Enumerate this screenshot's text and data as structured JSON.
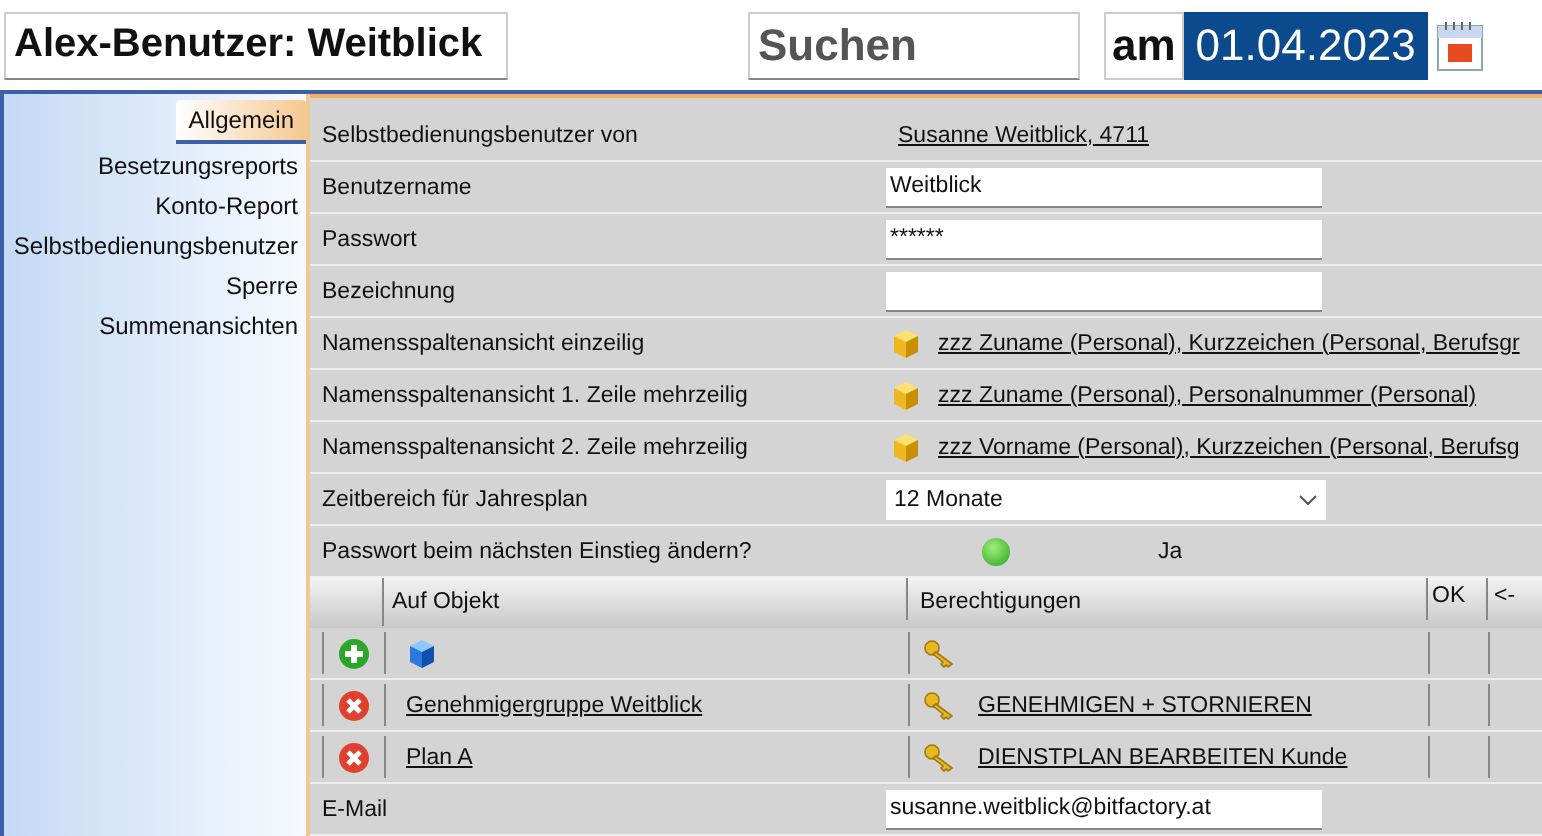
{
  "header": {
    "title": "Alex-Benutzer: Weitblick",
    "search": {
      "placeholder": "Suchen"
    },
    "date_label": "am",
    "date": "01.04.2023"
  },
  "sidebar": {
    "items": [
      {
        "label": "Allgemein",
        "selected": true
      },
      {
        "label": "Besetzungsreports",
        "selected": false
      },
      {
        "label": "Konto-Report",
        "selected": false
      },
      {
        "label": "Selbstbedienungsbenutzer",
        "selected": false
      },
      {
        "label": "Sperre",
        "selected": false
      },
      {
        "label": "Summenansichten",
        "selected": false
      }
    ]
  },
  "form": [
    {
      "kind": "link",
      "label": "Selbstbedienungsbenutzer von",
      "value": "Susanne Weitblick, 4711"
    },
    {
      "kind": "input",
      "label": "Benutzername",
      "value": "Weitblick"
    },
    {
      "kind": "input",
      "label": "Passwort",
      "value": "******"
    },
    {
      "kind": "input",
      "label": "Bezeichnung"
    },
    {
      "kind": "object",
      "label": "Namensspaltenansicht einzeilig",
      "value": "zzz Zuname (Personal), Kurzzeichen (Personal, Berufsgr"
    },
    {
      "kind": "object",
      "label": "Namensspaltenansicht 1. Zeile mehrzeilig",
      "value": "zzz Zuname (Personal), Personalnummer (Personal)"
    },
    {
      "kind": "object",
      "label": "Namensspaltenansicht 2. Zeile mehrzeilig",
      "value": "zzz Vorname (Personal), Kurzzeichen (Personal, Berufsg"
    },
    {
      "kind": "select",
      "label": "Zeitbereich für Jahresplan",
      "value": "12 Monate"
    },
    {
      "kind": "toggle",
      "label": "Passwort beim nächsten Einstieg ändern?",
      "on": true,
      "value": "Ja"
    },
    {
      "kind": "table",
      "columns": [
        "Auf Objekt",
        "Berechtigungen",
        "OK",
        "<-"
      ],
      "rows": [
        {
          "kind": "add"
        },
        {
          "kind": "remove",
          "object": "Genehmigergruppe Weitblick",
          "permission": "GENEHMIGEN + STORNIEREN"
        },
        {
          "kind": "remove",
          "object": "Plan A",
          "permission": "DIENSTPLAN BEARBEITEN Kunde"
        }
      ]
    },
    {
      "kind": "input",
      "label": "E-Mail",
      "value": "susanne.weitblick@bitfactory.at"
    }
  ]
}
